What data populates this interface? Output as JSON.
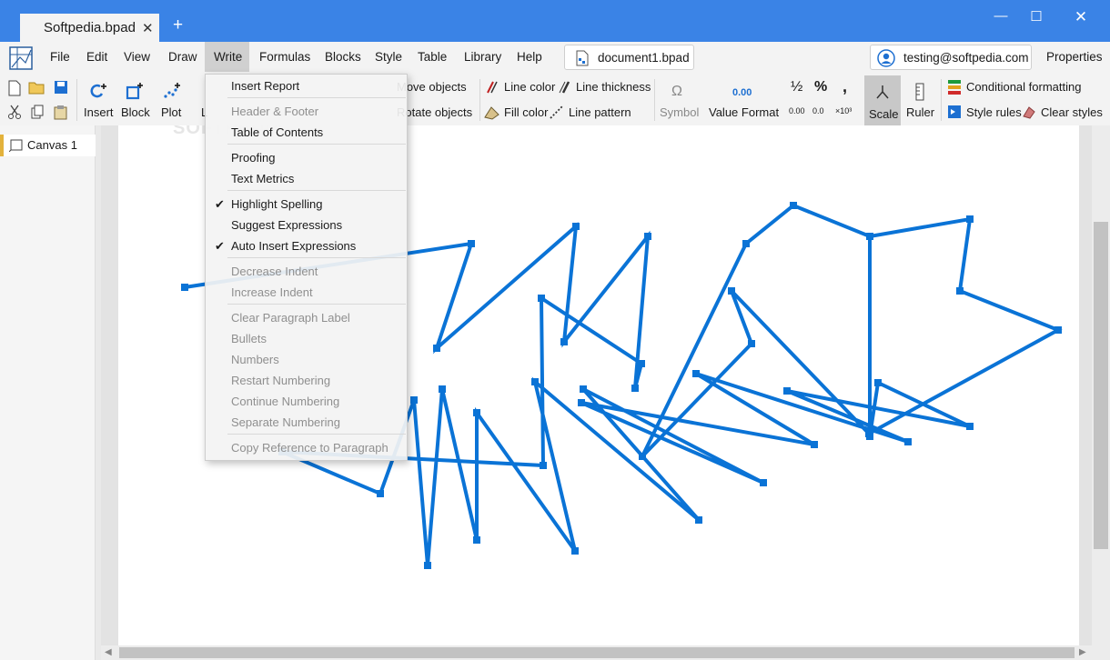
{
  "window": {
    "tab_title": "Softpedia.bpad",
    "new_tab": "+",
    "close_glyph": "✕",
    "min_glyph": "—",
    "max_glyph": "☐",
    "winclose_glyph": "✕"
  },
  "menubar": {
    "items": [
      "File",
      "Edit",
      "View",
      "Draw",
      "Write",
      "Formulas",
      "Blocks",
      "Style",
      "Table",
      "Library",
      "Help"
    ],
    "document": "document1.bpad",
    "account": "testing@softpedia.com",
    "properties": "Properties"
  },
  "ribbon": {
    "insert": "Insert",
    "block": "Block",
    "plot": "Plot",
    "partial_l": "L",
    "move_objects": "Move objects",
    "rotate_objects": "Rotate objects",
    "line_color": "Line color",
    "line_thickness": "Line thickness",
    "fill_color": "Fill color",
    "line_pattern": "Line pattern",
    "symbol": "Symbol",
    "symbol_glyph": "Ω",
    "value_format": "Value Format",
    "value_format_sample": "0.00",
    "half": "½",
    "percent": "%",
    "comma": ",",
    "dec_more": "0.00",
    "dec_less": "0.0",
    "sci": "×10³",
    "scale": "Scale",
    "ruler": "Ruler",
    "conditional_formatting": "Conditional formatting",
    "style_rules": "Style rules",
    "clear_styles": "Clear styles"
  },
  "sidebar": {
    "canvas_label": "Canvas 1"
  },
  "watermark": "SOFTPEDIA",
  "write_menu": {
    "insert_report": "Insert Report",
    "header_footer": "Header & Footer",
    "table_of_contents": "Table of Contents",
    "proofing": "Proofing",
    "text_metrics": "Text Metrics",
    "highlight_spelling": "Highlight Spelling",
    "suggest_expressions": "Suggest Expressions",
    "auto_insert_expressions": "Auto Insert Expressions",
    "decrease_indent": "Decrease Indent",
    "increase_indent": "Increase Indent",
    "clear_paragraph_label": "Clear Paragraph Label",
    "bullets": "Bullets",
    "numbers": "Numbers",
    "restart_numbering": "Restart Numbering",
    "continue_numbering": "Continue Numbering",
    "separate_numbering": "Separate Numbering",
    "copy_reference": "Copy Reference to Paragraph",
    "check_glyph": "✔"
  },
  "colors": {
    "titlebar": "#3a83e6",
    "stroke": "#0a73d6",
    "accent_tab": "#e3b23c"
  }
}
